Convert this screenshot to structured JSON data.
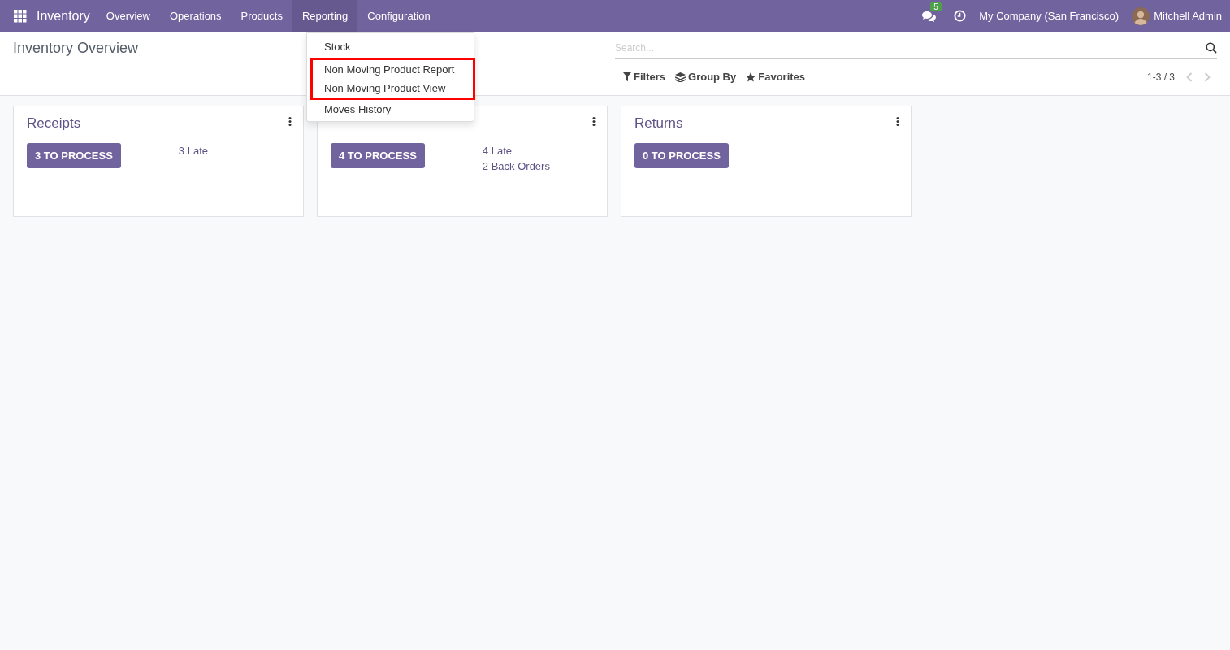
{
  "navbar": {
    "app_name": "Inventory",
    "menus": [
      {
        "label": "Overview",
        "selected": false
      },
      {
        "label": "Operations",
        "selected": false
      },
      {
        "label": "Products",
        "selected": false
      },
      {
        "label": "Reporting",
        "selected": true
      },
      {
        "label": "Configuration",
        "selected": false
      }
    ],
    "messages_badge": "5",
    "company": "My Company (San Francisco)",
    "user": "Mitchell Admin"
  },
  "dropdown": {
    "items": [
      {
        "label": "Stock",
        "highlighted": false
      },
      {
        "label": "Non Moving Product Report",
        "highlighted": true
      },
      {
        "label": "Non Moving Product View",
        "highlighted": true
      },
      {
        "label": "Moves History",
        "highlighted": false
      }
    ]
  },
  "control_panel": {
    "title": "Inventory Overview",
    "search": {
      "placeholder": "Search..."
    },
    "filters": [
      "Filters",
      "Group By",
      "Favorites"
    ],
    "pager": "1-3 / 3"
  },
  "cards": [
    {
      "title": "Receipts",
      "button": "3 TO PROCESS",
      "links": [
        "3 Late"
      ]
    },
    {
      "button": "4 TO PROCESS",
      "links": [
        "4 Late",
        "2 Back Orders"
      ]
    },
    {
      "title": "Returns",
      "button": "0 TO PROCESS"
    }
  ]
}
